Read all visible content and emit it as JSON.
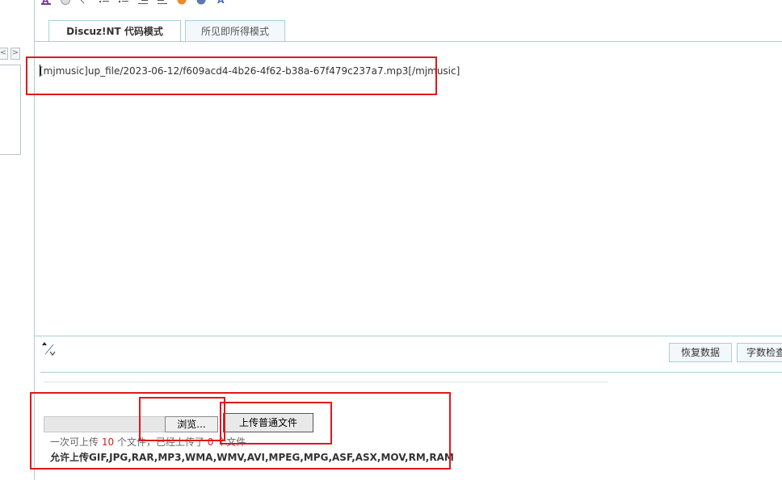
{
  "toolbar": {
    "icons": [
      "bold-a-icon",
      "smiley-icon",
      "code-icon",
      "ordered-list-icon",
      "unordered-list-icon",
      "indent-icon",
      "outdent-icon",
      "warning-icon",
      "help-icon",
      "font-icon"
    ]
  },
  "left_nav": {
    "prev": "<",
    "next": ">"
  },
  "tabs": [
    {
      "label": "Discuz!NT 代码模式",
      "active": true
    },
    {
      "label": "所见即所得模式",
      "active": false
    }
  ],
  "editor": {
    "content": "[mjmusic]up_file/2023-06-12/f609acd4-4b26-4f62-b38a-67f479c237a7.mp3[/mjmusic]"
  },
  "buttons": {
    "restore": "恢复数据",
    "word_count": "字数检查"
  },
  "upload": {
    "browse_label": "浏览...",
    "upload_label": "上传普通文件",
    "info_prefix": "一次可上传",
    "max_files": "10",
    "info_middle": "个文件，已经上传了",
    "uploaded_count": "0",
    "info_suffix": "个文件",
    "allowed_types": "允许上传GIF,JPG,RAR,MP3,WMA,WMV,AVI,MPEG,MPG,ASF,ASX,MOV,RM,RAM"
  },
  "colors": {
    "highlight": "#e3161a",
    "border": "#a9cfd9",
    "count_red": "#d4201c"
  }
}
